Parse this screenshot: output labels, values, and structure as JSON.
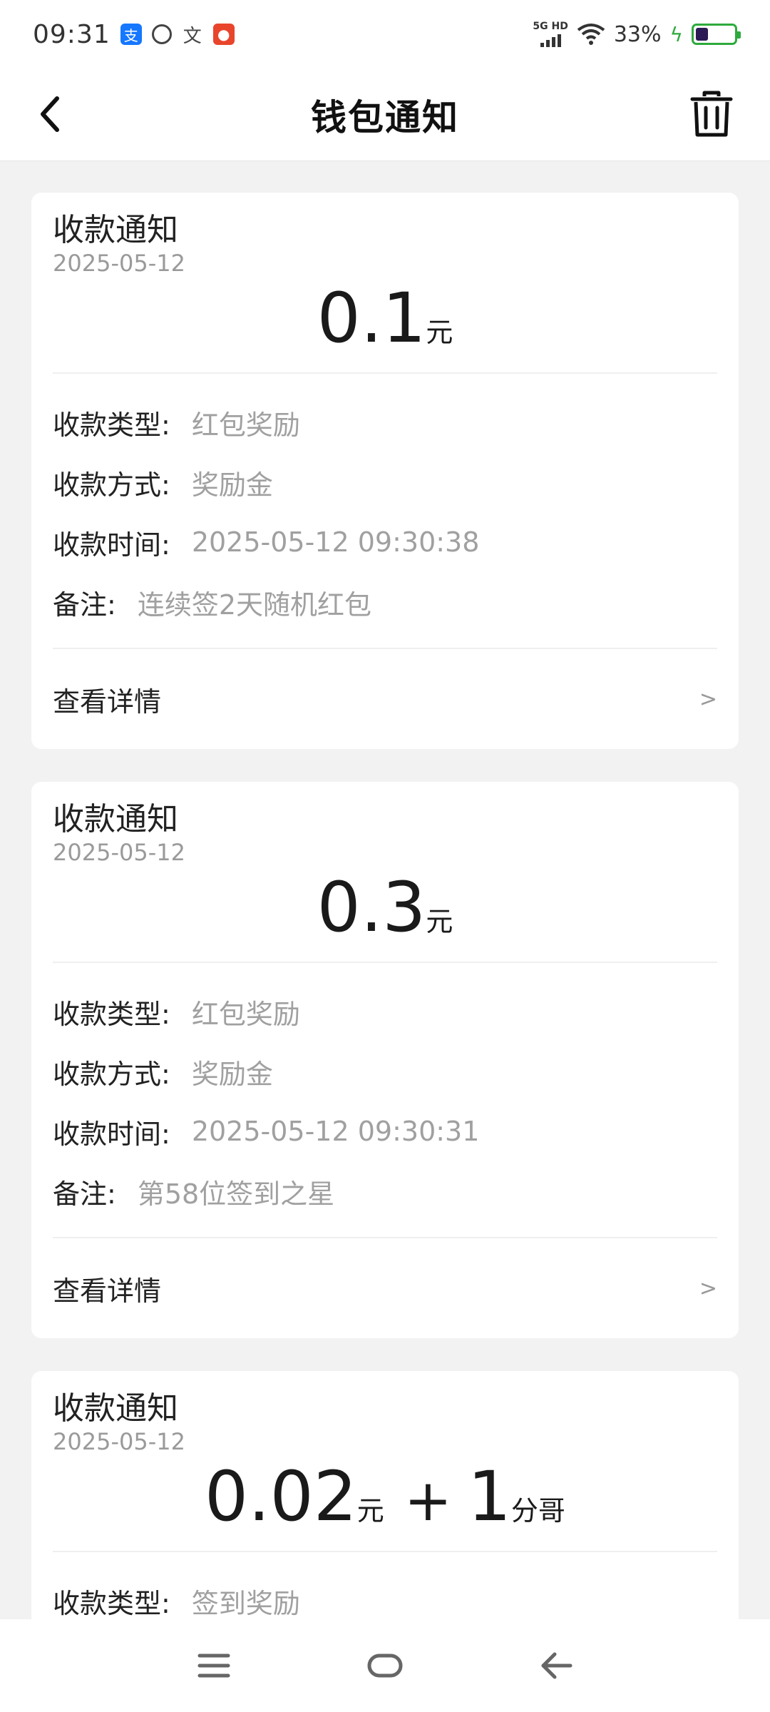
{
  "status_bar": {
    "time": "09:31",
    "network": "5G HD",
    "battery_percent": "33%",
    "battery_level": 0.33,
    "notification_icons": [
      "alipay-icon",
      "circle-app-icon",
      "text-app-icon",
      "red-app-icon"
    ]
  },
  "header": {
    "title": "钱包通知",
    "back_icon": "chevron-left-icon",
    "delete_icon": "trash-icon"
  },
  "cards": [
    {
      "title": "收款通知",
      "date": "2025-05-12",
      "amount": "0.1",
      "unit": "元",
      "details": [
        {
          "label": "收款类型:",
          "value": "红包奖励"
        },
        {
          "label": "收款方式:",
          "value": "奖励金"
        },
        {
          "label": "收款时间:",
          "value": "2025-05-12 09:30:38"
        },
        {
          "label": "备注:",
          "value": "连续签2天随机红包"
        }
      ],
      "link_label": "查看详情",
      "link_chevron": ">"
    },
    {
      "title": "收款通知",
      "date": "2025-05-12",
      "amount": "0.3",
      "unit": "元",
      "details": [
        {
          "label": "收款类型:",
          "value": "红包奖励"
        },
        {
          "label": "收款方式:",
          "value": "奖励金"
        },
        {
          "label": "收款时间:",
          "value": "2025-05-12 09:30:31"
        },
        {
          "label": "备注:",
          "value": "第58位签到之星"
        }
      ],
      "link_label": "查看详情",
      "link_chevron": ">"
    },
    {
      "title": "收款通知",
      "date": "2025-05-12",
      "amount": "0.02",
      "unit": "元",
      "plus": "+",
      "amount2": "1",
      "unit2": "分哥",
      "details": [
        {
          "label": "收款类型:",
          "value": "签到奖励"
        }
      ]
    }
  ],
  "nav_bar": {
    "icons": [
      "menu-icon",
      "home-icon",
      "back-arrow-icon"
    ]
  },
  "colors": {
    "background": "#f2f2f2",
    "card": "#ffffff",
    "text_primary": "#222222",
    "text_secondary": "#a0a0a0",
    "battery_green": "#2eaa3c"
  }
}
